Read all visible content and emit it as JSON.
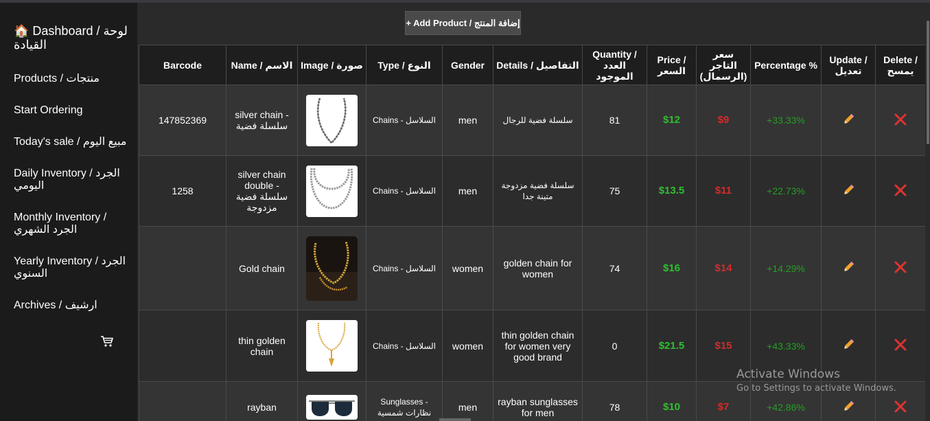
{
  "sidebar": {
    "dashboard": "🏠 Dashboard / لوحة القيادة",
    "items": [
      {
        "label": "Products / منتجات"
      },
      {
        "label": "Start Ordering"
      },
      {
        "label": "Today's sale / مبيع اليوم"
      },
      {
        "label": "Daily Inventory / الجرد اليومي"
      },
      {
        "label": "Monthly Inventory / الجرد الشهري"
      },
      {
        "label": "Yearly Inventory / الجرد السنوي"
      },
      {
        "label": "Archives / ارشيف"
      }
    ],
    "cart_icon": "shopping-cart-icon"
  },
  "toolbar": {
    "add_label": "+ Add Product / إضافة المنتج"
  },
  "table": {
    "headers": {
      "barcode": "Barcode",
      "name": "Name / الاسم",
      "image": "Image / صورة",
      "type": "Type / النوع",
      "gender": "Gender",
      "details": "Details / التفاصيل",
      "quantity": "Quantity / العدد الموجود",
      "price": "Price / السعر",
      "cost": "سعر التاجر (الرسمال)",
      "percentage": "Percentage %",
      "update": "Update / تعديل",
      "delete": "Delete / يمسح"
    },
    "rows": [
      {
        "barcode": "147852369",
        "name": "silver chain - سلسلة فضية",
        "image": "silver-chain-image",
        "type": "Chains - السلاسل",
        "gender": "men",
        "details": "سلسلة فضية للرجال",
        "quantity": "81",
        "price": "$12",
        "cost": "$9",
        "percentage": "+33.33%"
      },
      {
        "barcode": "1258",
        "name": "silver chain double - سلسلة فضية مزدوجة",
        "image": "silver-double-chain-image",
        "type": "Chains - السلاسل",
        "gender": "men",
        "details": "سلسلة فضية مزدوجة متينة جدا",
        "quantity": "75",
        "price": "$13.5",
        "cost": "$11",
        "percentage": "+22.73%"
      },
      {
        "barcode": "",
        "name": "Gold chain",
        "image": "gold-chain-image",
        "type": "Chains - السلاسل",
        "gender": "women",
        "details": "golden chain for women",
        "quantity": "74",
        "price": "$16",
        "cost": "$14",
        "percentage": "+14.29%"
      },
      {
        "barcode": "",
        "name": "thin golden chain",
        "image": "thin-golden-chain-image",
        "type": "Chains - السلاسل",
        "gender": "women",
        "details": "thin golden chain for women very good brand",
        "quantity": "0",
        "price": "$21.5",
        "cost": "$15",
        "percentage": "+43.33%"
      },
      {
        "barcode": "",
        "name": "rayban",
        "image": "rayban-sunglasses-image",
        "type": "Sunglasses - نظارات شمسية",
        "gender": "men",
        "details": "rayban sunglasses for men",
        "quantity": "78",
        "price": "$10",
        "cost": "$7",
        "percentage": "+42.86%"
      }
    ],
    "update_icon": "pencil-icon",
    "delete_icon": "close-icon"
  },
  "colors": {
    "price": "#2fbf2f",
    "cost": "#d22b2b",
    "percentage": "#22a022"
  },
  "watermark": {
    "title": "Activate Windows",
    "subtitle": "Go to Settings to activate Windows."
  }
}
